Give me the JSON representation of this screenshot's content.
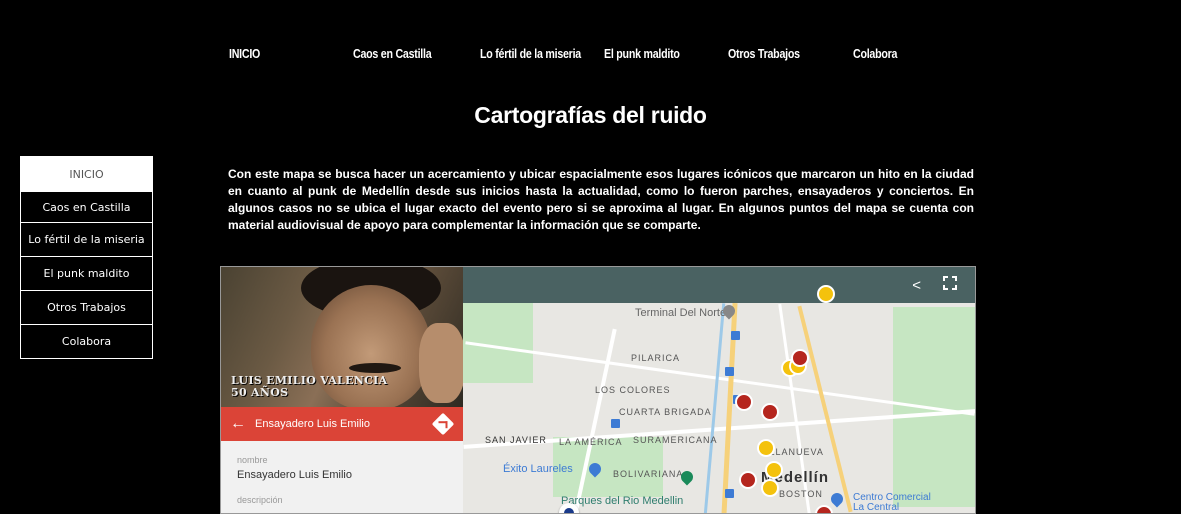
{
  "nav": {
    "items": [
      "INICIO",
      "Caos en Castilla",
      "Lo fértil de la miseria",
      "El punk maldito",
      "Otros Trabajos",
      "Colabora"
    ]
  },
  "page": {
    "title": "Cartografías del ruido",
    "intro": "Con este mapa se busca hacer un acercamiento y ubicar espacialmente esos lugares icónicos que marcaron un hito en la ciudad en cuanto al punk de Medellín desde sus inicios hasta la actualidad, como lo fueron parches, ensayaderos y conciertos. En algunos casos no se ubica el lugar exacto del evento pero si se aproxima al lugar. En algunos puntos del mapa se cuenta con material audiovisual de apoyo para complementar la información que se comparte."
  },
  "sidemenu": {
    "items": [
      "INICIO",
      "Caos en Castilla",
      "Lo fértil de la miseria",
      "El punk maldito",
      "Otros Trabajos",
      "Colabora"
    ]
  },
  "embed": {
    "photo_caption_line1": "LUIS EMILIO VALENCIA",
    "photo_caption_line2": "50 AÑOS",
    "panel_title": "Ensayadero Luis Emilio",
    "field1_label": "nombre",
    "field1_value": "Ensayadero Luis Emilio",
    "field2_label": "descripción",
    "map": {
      "labels": {
        "terminal": "Terminal Del Norte",
        "pilarica": "PILARICA",
        "los_colores": "LOS COLORES",
        "cuarta_brigada": "CUARTA BRIGADA",
        "san_javier": "SAN JAVIER",
        "la_america": "LA AMÉRICA",
        "suramericana": "SURAMERICANA",
        "villanueva": "VILLANUEVA",
        "exito": "Éxito Laureles",
        "bolivariana": "BOLIVARIANA",
        "medellin": "Medellín",
        "boston": "BOSTON",
        "parques": "Parques del Rio Medellin",
        "centro_comercial": "Centro Comercial La Central"
      }
    }
  },
  "colors": {
    "background": "#000000",
    "panel_red": "#db4437",
    "map_toolbar": "#4a6262",
    "pin_red": "#b5261e",
    "pin_yellow": "#f4c20d"
  },
  "icons": {
    "back": "arrow-left-icon",
    "directions": "directions-icon",
    "share": "share-icon",
    "fullscreen": "fullscreen-icon"
  }
}
